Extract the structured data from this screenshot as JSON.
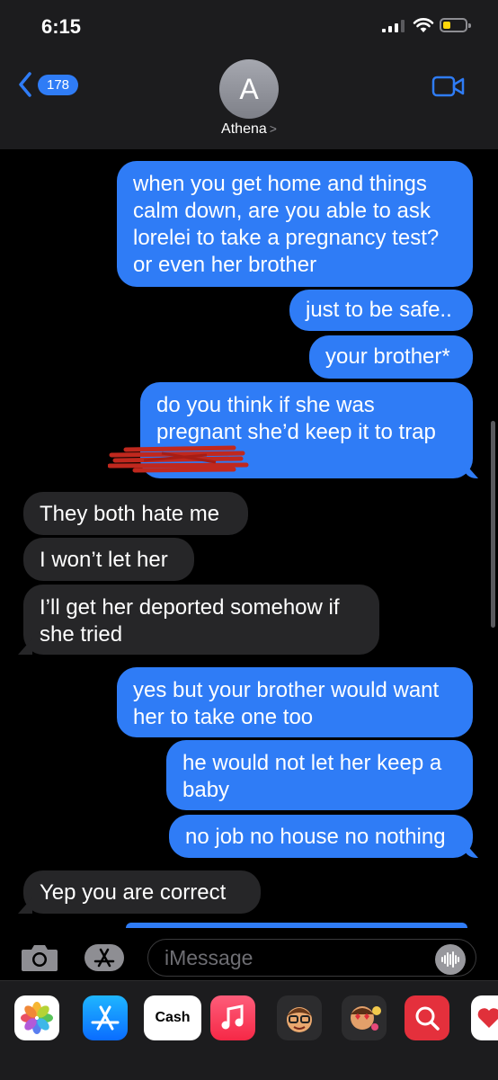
{
  "status_bar": {
    "time": "6:15"
  },
  "header": {
    "back_count": "178",
    "avatar_initial": "A",
    "contact_name": "Athena",
    "contact_chevron": ">"
  },
  "messages": [
    {
      "from": "me",
      "text": "when you get home and things calm down, are you able to ask lorelei to take a pregnancy test? or even her brother"
    },
    {
      "from": "me",
      "text": "just to be safe.."
    },
    {
      "from": "me",
      "text": "your brother*"
    },
    {
      "from": "me",
      "text": "do you think if she was pregnant she’d keep it to trap"
    },
    {
      "from": "them",
      "text": "They both hate me"
    },
    {
      "from": "them",
      "text": "I won’t let her"
    },
    {
      "from": "them",
      "text": "I’ll get her deported somehow if she tried"
    },
    {
      "from": "me",
      "text": "yes but your brother would want her to take one too"
    },
    {
      "from": "me",
      "text": "he would not let her keep a baby"
    },
    {
      "from": "me",
      "text": "no job no house no nothing"
    },
    {
      "from": "them",
      "text": "Yep you are correct"
    }
  ],
  "input": {
    "placeholder": "iMessage"
  },
  "app_drawer": {
    "apps": [
      "photos-icon",
      "app-store-icon",
      "cash-icon",
      "music-icon",
      "memoji-icon",
      "memoji-icon",
      "search-icon",
      "heart-icon"
    ],
    "cash_label": "Cash",
    "cash_glyph": ""
  },
  "colors": {
    "sent": "#2f7cf6",
    "received": "#262628",
    "header": "#1c1c1e",
    "redaction": "#c0281e"
  }
}
